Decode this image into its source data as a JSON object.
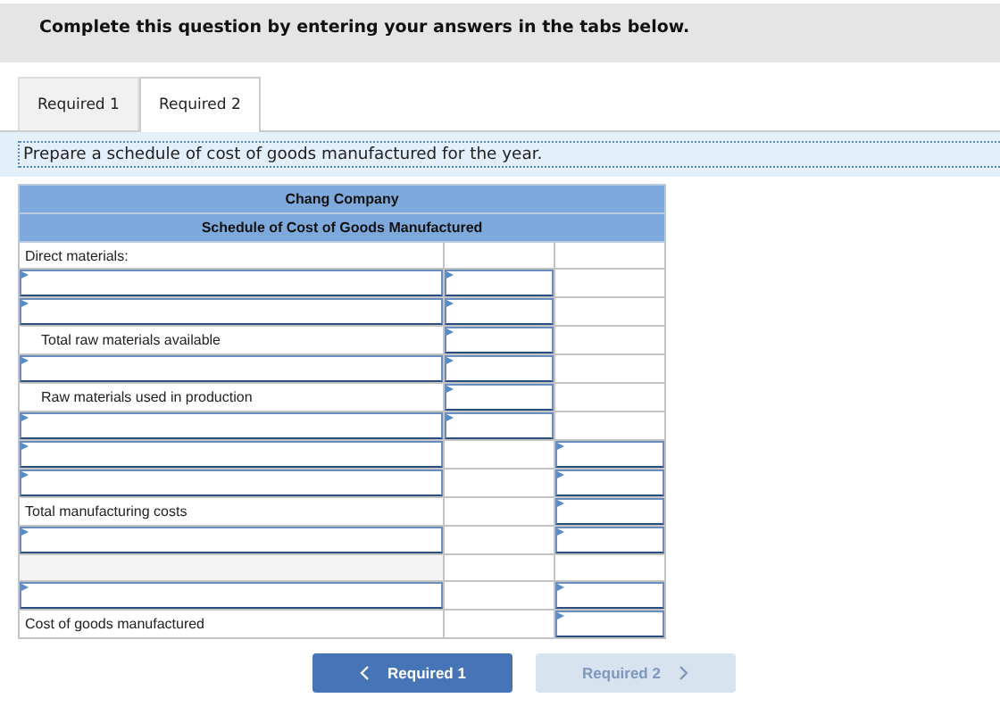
{
  "banner": {
    "text": "Complete this question by entering your answers in the tabs below."
  },
  "tabs": [
    {
      "label": "Required 1",
      "selected": false
    },
    {
      "label": "Required 2",
      "selected": true
    }
  ],
  "instruction": "Prepare a schedule of cost of goods manufactured for the year.",
  "schedule": {
    "company": "Chang Company",
    "title": "Schedule of Cost of Goods Manufactured",
    "rows": [
      {
        "kind": "label",
        "label": "Direct materials:",
        "indent": false,
        "cells": [
          {
            "input": false
          },
          {
            "input": false
          }
        ]
      },
      {
        "kind": "input",
        "cells": [
          {
            "input": true
          },
          {
            "input": false
          }
        ]
      },
      {
        "kind": "input",
        "cells": [
          {
            "input": true
          },
          {
            "input": false
          }
        ]
      },
      {
        "kind": "label",
        "label": "Total raw materials available",
        "indent": true,
        "cells": [
          {
            "input": true
          },
          {
            "input": false
          }
        ]
      },
      {
        "kind": "input",
        "cells": [
          {
            "input": true
          },
          {
            "input": false
          }
        ]
      },
      {
        "kind": "label",
        "label": "Raw materials used in production",
        "indent": true,
        "cells": [
          {
            "input": true
          },
          {
            "input": false
          }
        ]
      },
      {
        "kind": "input",
        "cells": [
          {
            "input": true
          },
          {
            "input": false
          }
        ]
      },
      {
        "kind": "input",
        "cells": [
          {
            "input": false
          },
          {
            "input": true
          }
        ]
      },
      {
        "kind": "input",
        "cells": [
          {
            "input": false
          },
          {
            "input": true
          }
        ]
      },
      {
        "kind": "label",
        "label": "Total manufacturing costs",
        "indent": false,
        "cells": [
          {
            "input": false
          },
          {
            "input": true
          }
        ]
      },
      {
        "kind": "input",
        "cells": [
          {
            "input": false
          },
          {
            "input": true
          }
        ]
      },
      {
        "kind": "empty",
        "cells": [
          {
            "input": false
          },
          {
            "input": false
          }
        ]
      },
      {
        "kind": "input",
        "cells": [
          {
            "input": false
          },
          {
            "input": true
          }
        ]
      },
      {
        "kind": "label",
        "label": "Cost of goods manufactured",
        "indent": false,
        "cells": [
          {
            "input": false
          },
          {
            "input": true
          }
        ]
      }
    ]
  },
  "nav": [
    {
      "label": "Required 1",
      "kind": "prev",
      "disabled": false
    },
    {
      "label": "Required 2",
      "kind": "next",
      "disabled": true
    }
  ]
}
